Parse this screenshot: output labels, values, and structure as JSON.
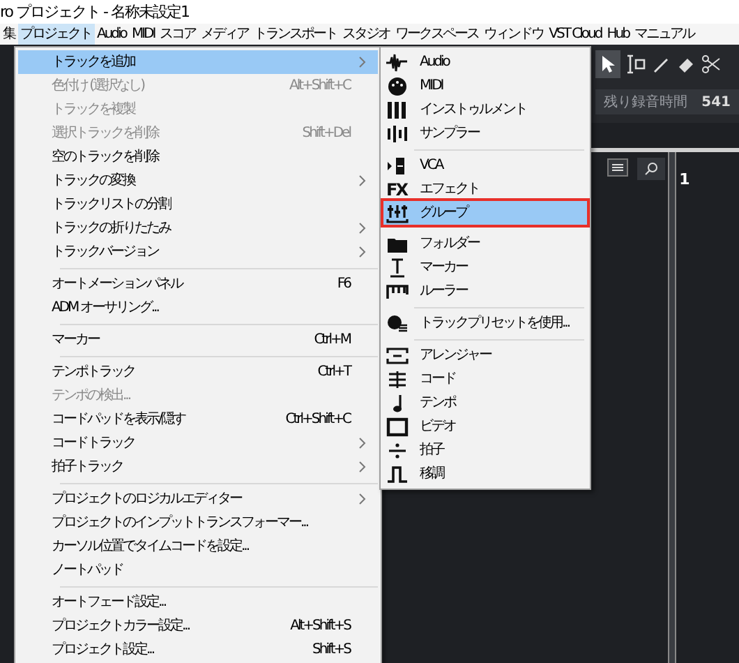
{
  "window": {
    "title": "ro プロジェクト - 名称未設定1"
  },
  "menubar": [
    {
      "label": "集",
      "selected": false
    },
    {
      "label": "プロジェクト",
      "selected": true
    },
    {
      "label": "Audio",
      "selected": false
    },
    {
      "label": "MIDI",
      "selected": false
    },
    {
      "label": "スコア",
      "selected": false
    },
    {
      "label": "メディア",
      "selected": false
    },
    {
      "label": "トランスポート",
      "selected": false
    },
    {
      "label": "スタジオ",
      "selected": false
    },
    {
      "label": "ワークスペース",
      "selected": false
    },
    {
      "label": "ウィンドウ",
      "selected": false
    },
    {
      "label": "VST Cloud",
      "selected": false
    },
    {
      "label": "Hub",
      "selected": false
    },
    {
      "label": "マニュアル",
      "selected": false
    }
  ],
  "project_menu": [
    {
      "kind": "item",
      "label": "トラックを追加",
      "submenu": true,
      "disabled": false,
      "selected": true
    },
    {
      "kind": "item",
      "label": "色付け (選択なし)",
      "shortcut": "Alt+Shift+C",
      "submenu": false,
      "disabled": true,
      "selected": false
    },
    {
      "kind": "item",
      "label": "トラックを複製",
      "submenu": false,
      "disabled": true,
      "selected": false
    },
    {
      "kind": "item",
      "label": "選択トラックを削除",
      "shortcut": "Shift+Del",
      "submenu": false,
      "disabled": true,
      "selected": false
    },
    {
      "kind": "item",
      "label": "空のトラックを削除",
      "submenu": false,
      "disabled": false,
      "selected": false
    },
    {
      "kind": "item",
      "label": "トラックの変換",
      "submenu": true,
      "disabled": false,
      "selected": false
    },
    {
      "kind": "item",
      "label": "トラックリストの分割",
      "submenu": false,
      "disabled": false,
      "selected": false
    },
    {
      "kind": "item",
      "label": "トラックの折りたたみ",
      "submenu": true,
      "disabled": false,
      "selected": false
    },
    {
      "kind": "item",
      "label": "トラックバージョン",
      "submenu": true,
      "disabled": false,
      "selected": false
    },
    {
      "kind": "separator"
    },
    {
      "kind": "item",
      "label": "オートメーションパネル",
      "shortcut": "F6",
      "submenu": false,
      "disabled": false,
      "selected": false
    },
    {
      "kind": "item",
      "label": "ADM オーサリング...",
      "submenu": false,
      "disabled": false,
      "selected": false
    },
    {
      "kind": "separator"
    },
    {
      "kind": "item",
      "label": "マーカー",
      "shortcut": "Ctrl+M",
      "submenu": false,
      "disabled": false,
      "selected": false
    },
    {
      "kind": "separator"
    },
    {
      "kind": "item",
      "label": "テンポトラック",
      "shortcut": "Ctrl+T",
      "submenu": false,
      "disabled": false,
      "selected": false
    },
    {
      "kind": "item",
      "label": "テンポの検出...",
      "submenu": false,
      "disabled": true,
      "selected": false
    },
    {
      "kind": "item",
      "label": "コードパッドを表示/隠す",
      "shortcut": "Ctrl+Shift+C",
      "submenu": false,
      "disabled": false,
      "selected": false
    },
    {
      "kind": "item",
      "label": "コードトラック",
      "submenu": true,
      "disabled": false,
      "selected": false
    },
    {
      "kind": "item",
      "label": "拍子トラック",
      "submenu": true,
      "disabled": false,
      "selected": false
    },
    {
      "kind": "separator"
    },
    {
      "kind": "item",
      "label": "プロジェクトのロジカルエディター",
      "submenu": true,
      "disabled": false,
      "selected": false
    },
    {
      "kind": "item",
      "label": "プロジェクトのインプットトランスフォーマー...",
      "submenu": false,
      "disabled": false,
      "selected": false
    },
    {
      "kind": "item",
      "label": "カーソル位置でタイムコードを設定...",
      "submenu": false,
      "disabled": false,
      "selected": false
    },
    {
      "kind": "item",
      "label": "ノートパッド",
      "submenu": false,
      "disabled": false,
      "selected": false
    },
    {
      "kind": "separator"
    },
    {
      "kind": "item",
      "label": "オートフェード設定...",
      "submenu": false,
      "disabled": false,
      "selected": false
    },
    {
      "kind": "item",
      "label": "プロジェクトカラー設定...",
      "shortcut": "Alt+Shift+S",
      "submenu": false,
      "disabled": false,
      "selected": false
    },
    {
      "kind": "item",
      "label": "プロジェクト設定...",
      "shortcut": "Shift+S",
      "submenu": false,
      "disabled": false,
      "selected": false
    }
  ],
  "add_track_submenu": [
    {
      "kind": "waveform",
      "label": "Audio",
      "selected": false,
      "annotated": false
    },
    {
      "kind": "midi",
      "label": "MIDI",
      "selected": false,
      "annotated": false
    },
    {
      "kind": "instrument",
      "label": "インストゥルメント",
      "selected": false,
      "annotated": false
    },
    {
      "kind": "sampler",
      "label": "サンプラー",
      "selected": false,
      "annotated": false
    },
    {
      "kind": "separator"
    },
    {
      "kind": "vca",
      "label": "VCA",
      "selected": false,
      "annotated": false
    },
    {
      "kind": "fx",
      "icon_text": "FX",
      "label": "エフェクト",
      "selected": false,
      "annotated": false
    },
    {
      "kind": "group",
      "label": "グループ",
      "selected": true,
      "annotated": true
    },
    {
      "kind": "gap"
    },
    {
      "kind": "folder",
      "label": "フォルダー",
      "selected": false,
      "annotated": false
    },
    {
      "kind": "marker",
      "label": "マーカー",
      "selected": false,
      "annotated": false
    },
    {
      "kind": "ruler",
      "label": "ルーラー",
      "selected": false,
      "annotated": false
    },
    {
      "kind": "separator"
    },
    {
      "kind": "preset",
      "label": "トラックプリセットを使用...",
      "selected": false,
      "annotated": false
    },
    {
      "kind": "separator"
    },
    {
      "kind": "arranger",
      "label": "アレンジャー",
      "selected": false,
      "annotated": false
    },
    {
      "kind": "chord",
      "label": "コード",
      "selected": false,
      "annotated": false
    },
    {
      "kind": "tempo",
      "label": "テンポ",
      "selected": false,
      "annotated": false
    },
    {
      "kind": "video",
      "label": "ビデオ",
      "selected": false,
      "annotated": false
    },
    {
      "kind": "signature",
      "label": "拍子",
      "selected": false,
      "annotated": false
    },
    {
      "kind": "transpose",
      "label": "移調",
      "selected": false,
      "annotated": false
    }
  ],
  "status": {
    "label": "残り録音時間",
    "value": "541"
  },
  "ruler": {
    "bar": "1"
  }
}
